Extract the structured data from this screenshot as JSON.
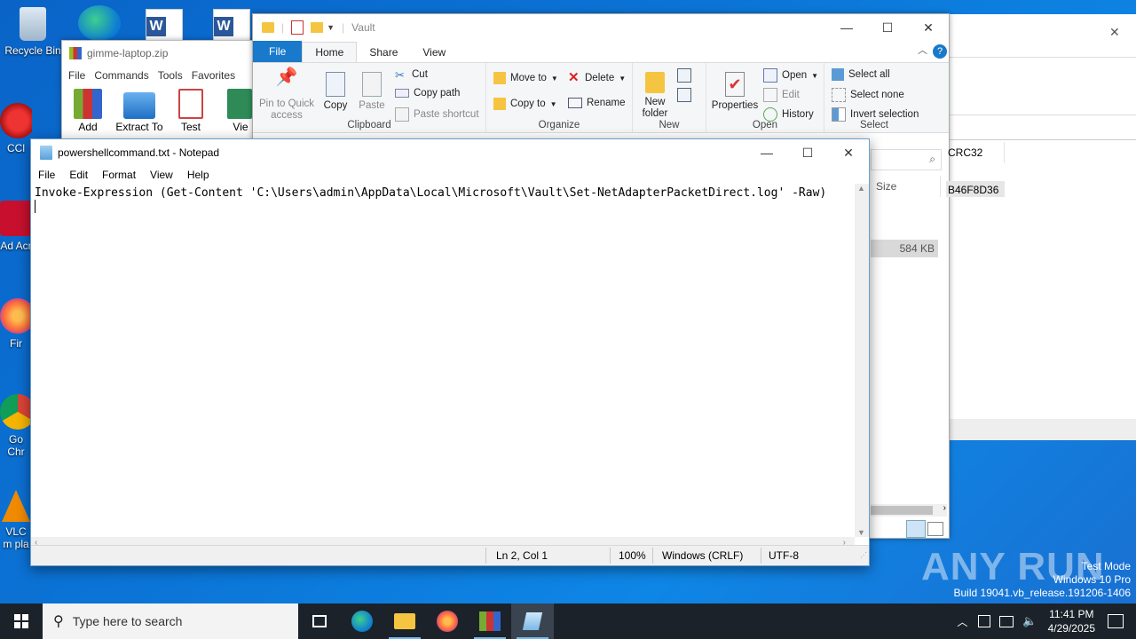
{
  "desktop": {
    "icons": [
      {
        "label": "Recycle Bin"
      },
      {
        "label": "CCl"
      },
      {
        "label": "Ad Acr"
      },
      {
        "label": "Fir"
      },
      {
        "label": "Go Chr"
      },
      {
        "label": "VLC m pla"
      }
    ],
    "watermark": {
      "brand": "ANY RUN",
      "line1": "Test Mode",
      "line2": "Windows 10 Pro",
      "line3": "Build 19041.vb_release.191206-1406"
    }
  },
  "winrar": {
    "title": "gimme-laptop.zip",
    "menu": [
      "File",
      "Commands",
      "Tools",
      "Favorites"
    ],
    "toolbar": [
      "Add",
      "Extract To",
      "Test",
      "Vie"
    ]
  },
  "explorer": {
    "title": "Vault",
    "tabs": [
      "File",
      "Home",
      "Share",
      "View"
    ],
    "clipboard": {
      "pin": "Pin to Quick access",
      "copy": "Copy",
      "paste": "Paste",
      "cut": "Cut",
      "copy_path": "Copy path",
      "paste_shortcut": "Paste shortcut",
      "title": "Clipboard"
    },
    "organize": {
      "move_to": "Move to",
      "copy_to": "Copy to",
      "delete": "Delete",
      "rename": "Rename",
      "title": "Organize"
    },
    "new": {
      "new_folder": "New folder",
      "title": "New"
    },
    "open": {
      "properties": "Properties",
      "open": "Open",
      "edit": "Edit",
      "history": "History",
      "title": "Open"
    },
    "select": {
      "select_all": "Select all",
      "select_none": "Select none",
      "invert": "Invert selection",
      "title": "Select"
    },
    "list": {
      "size_header": "Size",
      "size_value": "584 KB",
      "crc_header": "CRC32",
      "crc_value": "B46F8D36"
    }
  },
  "notepad": {
    "title": "powershellcommand.txt - Notepad",
    "menu": [
      "File",
      "Edit",
      "Format",
      "View",
      "Help"
    ],
    "content": "Invoke-Expression (Get-Content 'C:\\Users\\admin\\AppData\\Local\\Microsoft\\Vault\\Set-NetAdapterPacketDirect.log' -Raw)",
    "status": {
      "position": "Ln 2, Col 1",
      "zoom": "100%",
      "line_ending": "Windows (CRLF)",
      "encoding": "UTF-8"
    }
  },
  "taskbar": {
    "search_placeholder": "Type here to search",
    "time": "11:41 PM",
    "date": "4/29/2025"
  },
  "colors": {
    "accent": "#1979ca",
    "taskbar": "#1c2229",
    "desktop": "#0b74d6"
  }
}
